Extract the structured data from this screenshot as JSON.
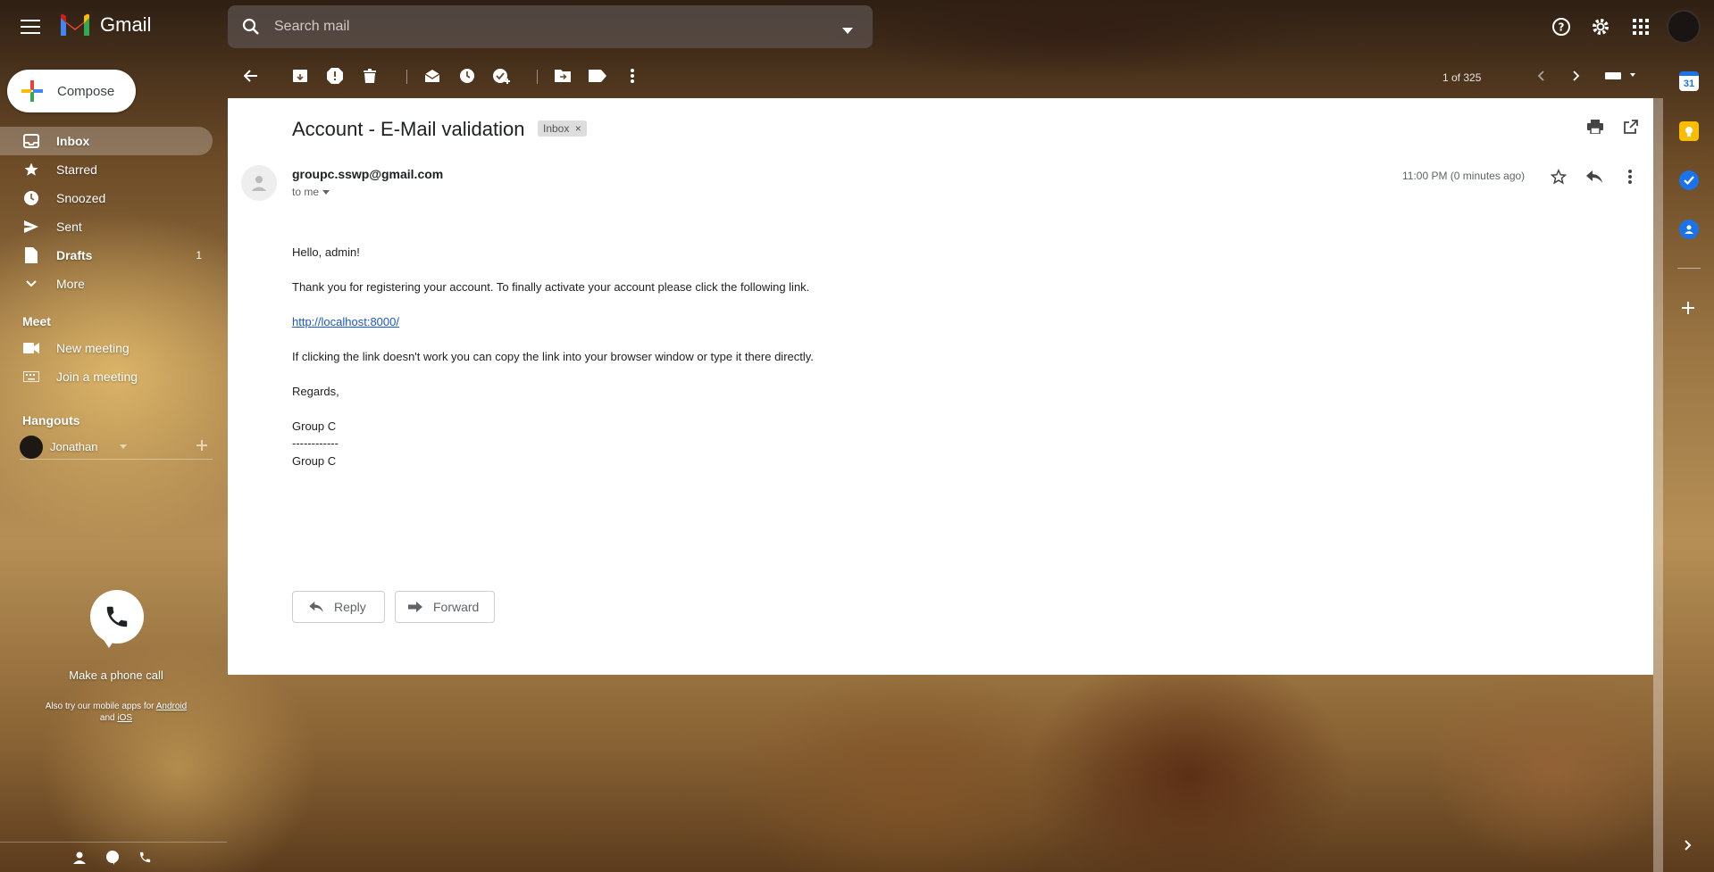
{
  "header": {
    "app_name": "Gmail",
    "search_placeholder": "Search mail"
  },
  "sidebar": {
    "compose_label": "Compose",
    "items": [
      {
        "label": "Inbox",
        "count": ""
      },
      {
        "label": "Starred",
        "count": ""
      },
      {
        "label": "Snoozed",
        "count": ""
      },
      {
        "label": "Sent",
        "count": ""
      },
      {
        "label": "Drafts",
        "count": "1"
      },
      {
        "label": "More",
        "count": ""
      }
    ],
    "meet": {
      "title": "Meet",
      "new_meeting": "New meeting",
      "join_meeting": "Join a meeting"
    },
    "hangouts": {
      "title": "Hangouts",
      "user": "Jonathan"
    },
    "phone": {
      "label": "Make a phone call",
      "apps_prefix": "Also try our mobile apps for",
      "android": "Android",
      "and": "and",
      "ios": "iOS"
    }
  },
  "toolbar": {
    "pager": "1 of 325"
  },
  "email": {
    "subject": "Account - E-Mail validation",
    "label_chip": "Inbox",
    "sender": "groupc.sswp@gmail.com",
    "to": "to me",
    "time": "11:00 PM (0 minutes ago)",
    "body": {
      "greeting": "Hello, admin!",
      "line1": "Thank you for registering your account. To finally activate your account please click the following link.",
      "link": "http://localhost:8000/",
      "line2": "If clicking the link doesn't work you can copy the link into your browser window or type it there directly.",
      "regards": "Regards,",
      "sig1": "Group C",
      "sig_sep": "------------",
      "sig2": "Group C"
    },
    "reply_label": "Reply",
    "forward_label": "Forward"
  },
  "right_rail": {
    "calendar_day": "31"
  },
  "colors": {
    "accent_blue": "#1a73e8",
    "link": "#1a57c8",
    "keep_yellow": "#fbbc04"
  }
}
